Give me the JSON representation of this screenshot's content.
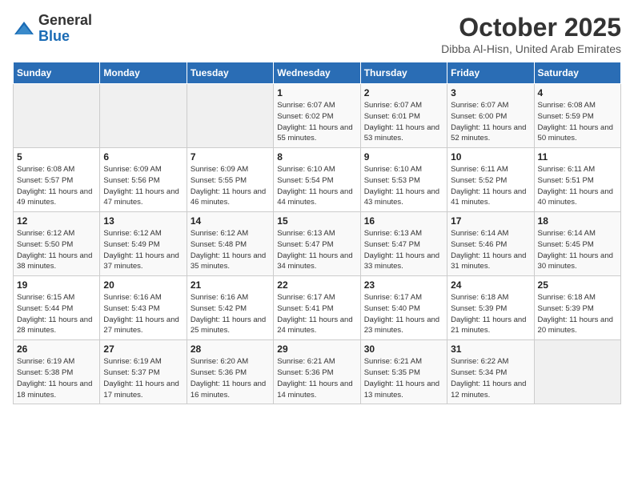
{
  "header": {
    "logo": {
      "line1": "General",
      "line2": "Blue"
    },
    "title": "October 2025",
    "location": "Dibba Al-Hisn, United Arab Emirates"
  },
  "weekdays": [
    "Sunday",
    "Monday",
    "Tuesday",
    "Wednesday",
    "Thursday",
    "Friday",
    "Saturday"
  ],
  "weeks": [
    [
      {
        "day": "",
        "sunrise": "",
        "sunset": "",
        "daylight": ""
      },
      {
        "day": "",
        "sunrise": "",
        "sunset": "",
        "daylight": ""
      },
      {
        "day": "",
        "sunrise": "",
        "sunset": "",
        "daylight": ""
      },
      {
        "day": "1",
        "sunrise": "Sunrise: 6:07 AM",
        "sunset": "Sunset: 6:02 PM",
        "daylight": "Daylight: 11 hours and 55 minutes."
      },
      {
        "day": "2",
        "sunrise": "Sunrise: 6:07 AM",
        "sunset": "Sunset: 6:01 PM",
        "daylight": "Daylight: 11 hours and 53 minutes."
      },
      {
        "day": "3",
        "sunrise": "Sunrise: 6:07 AM",
        "sunset": "Sunset: 6:00 PM",
        "daylight": "Daylight: 11 hours and 52 minutes."
      },
      {
        "day": "4",
        "sunrise": "Sunrise: 6:08 AM",
        "sunset": "Sunset: 5:59 PM",
        "daylight": "Daylight: 11 hours and 50 minutes."
      }
    ],
    [
      {
        "day": "5",
        "sunrise": "Sunrise: 6:08 AM",
        "sunset": "Sunset: 5:57 PM",
        "daylight": "Daylight: 11 hours and 49 minutes."
      },
      {
        "day": "6",
        "sunrise": "Sunrise: 6:09 AM",
        "sunset": "Sunset: 5:56 PM",
        "daylight": "Daylight: 11 hours and 47 minutes."
      },
      {
        "day": "7",
        "sunrise": "Sunrise: 6:09 AM",
        "sunset": "Sunset: 5:55 PM",
        "daylight": "Daylight: 11 hours and 46 minutes."
      },
      {
        "day": "8",
        "sunrise": "Sunrise: 6:10 AM",
        "sunset": "Sunset: 5:54 PM",
        "daylight": "Daylight: 11 hours and 44 minutes."
      },
      {
        "day": "9",
        "sunrise": "Sunrise: 6:10 AM",
        "sunset": "Sunset: 5:53 PM",
        "daylight": "Daylight: 11 hours and 43 minutes."
      },
      {
        "day": "10",
        "sunrise": "Sunrise: 6:11 AM",
        "sunset": "Sunset: 5:52 PM",
        "daylight": "Daylight: 11 hours and 41 minutes."
      },
      {
        "day": "11",
        "sunrise": "Sunrise: 6:11 AM",
        "sunset": "Sunset: 5:51 PM",
        "daylight": "Daylight: 11 hours and 40 minutes."
      }
    ],
    [
      {
        "day": "12",
        "sunrise": "Sunrise: 6:12 AM",
        "sunset": "Sunset: 5:50 PM",
        "daylight": "Daylight: 11 hours and 38 minutes."
      },
      {
        "day": "13",
        "sunrise": "Sunrise: 6:12 AM",
        "sunset": "Sunset: 5:49 PM",
        "daylight": "Daylight: 11 hours and 37 minutes."
      },
      {
        "day": "14",
        "sunrise": "Sunrise: 6:12 AM",
        "sunset": "Sunset: 5:48 PM",
        "daylight": "Daylight: 11 hours and 35 minutes."
      },
      {
        "day": "15",
        "sunrise": "Sunrise: 6:13 AM",
        "sunset": "Sunset: 5:47 PM",
        "daylight": "Daylight: 11 hours and 34 minutes."
      },
      {
        "day": "16",
        "sunrise": "Sunrise: 6:13 AM",
        "sunset": "Sunset: 5:47 PM",
        "daylight": "Daylight: 11 hours and 33 minutes."
      },
      {
        "day": "17",
        "sunrise": "Sunrise: 6:14 AM",
        "sunset": "Sunset: 5:46 PM",
        "daylight": "Daylight: 11 hours and 31 minutes."
      },
      {
        "day": "18",
        "sunrise": "Sunrise: 6:14 AM",
        "sunset": "Sunset: 5:45 PM",
        "daylight": "Daylight: 11 hours and 30 minutes."
      }
    ],
    [
      {
        "day": "19",
        "sunrise": "Sunrise: 6:15 AM",
        "sunset": "Sunset: 5:44 PM",
        "daylight": "Daylight: 11 hours and 28 minutes."
      },
      {
        "day": "20",
        "sunrise": "Sunrise: 6:16 AM",
        "sunset": "Sunset: 5:43 PM",
        "daylight": "Daylight: 11 hours and 27 minutes."
      },
      {
        "day": "21",
        "sunrise": "Sunrise: 6:16 AM",
        "sunset": "Sunset: 5:42 PM",
        "daylight": "Daylight: 11 hours and 25 minutes."
      },
      {
        "day": "22",
        "sunrise": "Sunrise: 6:17 AM",
        "sunset": "Sunset: 5:41 PM",
        "daylight": "Daylight: 11 hours and 24 minutes."
      },
      {
        "day": "23",
        "sunrise": "Sunrise: 6:17 AM",
        "sunset": "Sunset: 5:40 PM",
        "daylight": "Daylight: 11 hours and 23 minutes."
      },
      {
        "day": "24",
        "sunrise": "Sunrise: 6:18 AM",
        "sunset": "Sunset: 5:39 PM",
        "daylight": "Daylight: 11 hours and 21 minutes."
      },
      {
        "day": "25",
        "sunrise": "Sunrise: 6:18 AM",
        "sunset": "Sunset: 5:39 PM",
        "daylight": "Daylight: 11 hours and 20 minutes."
      }
    ],
    [
      {
        "day": "26",
        "sunrise": "Sunrise: 6:19 AM",
        "sunset": "Sunset: 5:38 PM",
        "daylight": "Daylight: 11 hours and 18 minutes."
      },
      {
        "day": "27",
        "sunrise": "Sunrise: 6:19 AM",
        "sunset": "Sunset: 5:37 PM",
        "daylight": "Daylight: 11 hours and 17 minutes."
      },
      {
        "day": "28",
        "sunrise": "Sunrise: 6:20 AM",
        "sunset": "Sunset: 5:36 PM",
        "daylight": "Daylight: 11 hours and 16 minutes."
      },
      {
        "day": "29",
        "sunrise": "Sunrise: 6:21 AM",
        "sunset": "Sunset: 5:36 PM",
        "daylight": "Daylight: 11 hours and 14 minutes."
      },
      {
        "day": "30",
        "sunrise": "Sunrise: 6:21 AM",
        "sunset": "Sunset: 5:35 PM",
        "daylight": "Daylight: 11 hours and 13 minutes."
      },
      {
        "day": "31",
        "sunrise": "Sunrise: 6:22 AM",
        "sunset": "Sunset: 5:34 PM",
        "daylight": "Daylight: 11 hours and 12 minutes."
      },
      {
        "day": "",
        "sunrise": "",
        "sunset": "",
        "daylight": ""
      }
    ]
  ]
}
